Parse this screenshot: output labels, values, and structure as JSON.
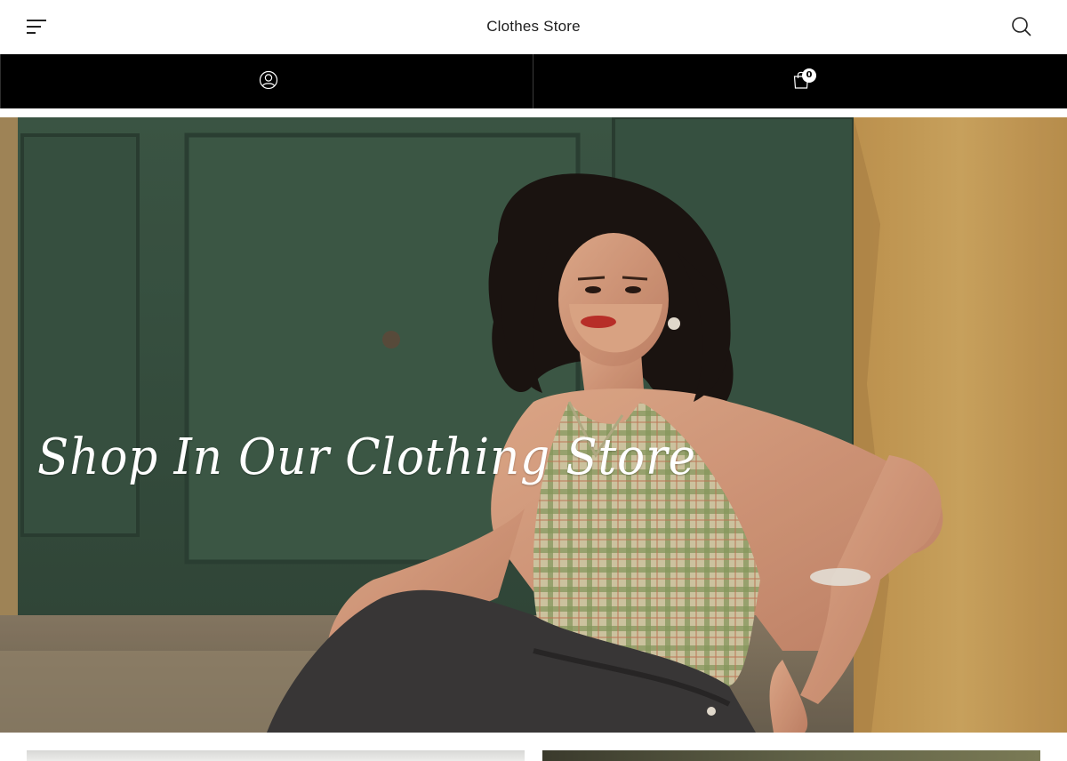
{
  "header": {
    "title": "Clothes Store",
    "menu_icon": "hamburger-menu-icon",
    "search_icon": "search-icon"
  },
  "account_bar": {
    "account_icon": "user-account-icon",
    "cart_icon": "shopping-bag-icon",
    "cart_count": "0"
  },
  "hero": {
    "heading": "Shop In Our Clothing Store"
  },
  "colors": {
    "header_bg": "#ffffff",
    "bar_bg": "#000000",
    "hero_text": "#ffffff",
    "title_text": "#1e1e1e"
  }
}
